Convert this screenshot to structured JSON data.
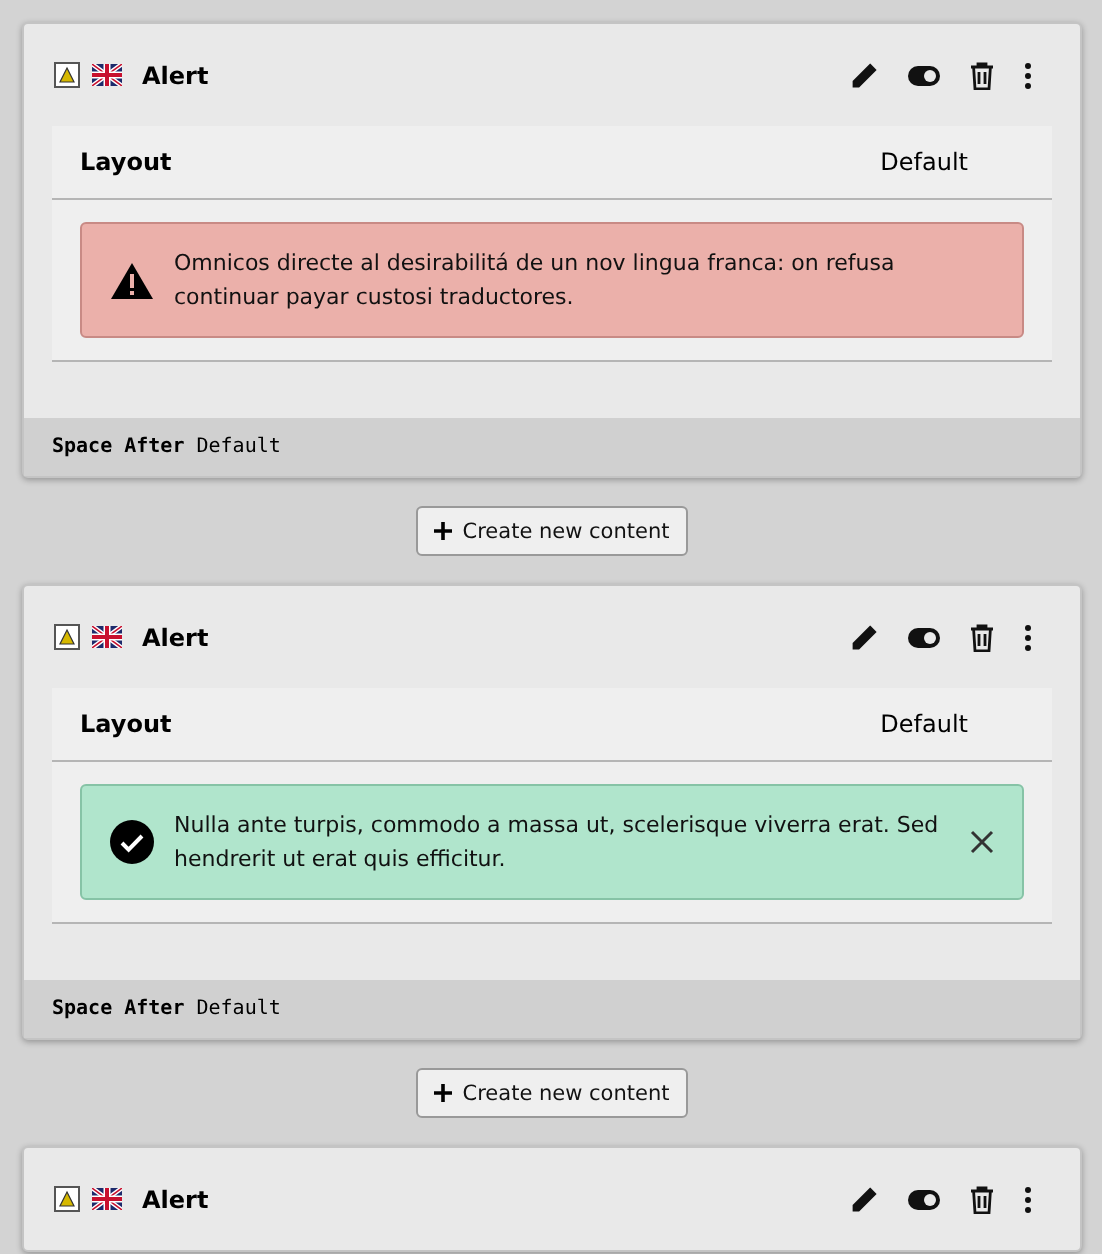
{
  "items": [
    {
      "kind": "card",
      "title": "Alert",
      "layout": {
        "label": "Layout",
        "value": "Default"
      },
      "alert": {
        "kind": "danger",
        "text": "Omnicos directe al desirabilitá de un nov lingua franca: on refusa continuar payar custosi traductores.",
        "dismissible": false
      },
      "footer": {
        "label": "Space After",
        "value": "Default"
      }
    },
    {
      "kind": "create",
      "label": "Create new content"
    },
    {
      "kind": "card",
      "title": "Alert",
      "layout": {
        "label": "Layout",
        "value": "Default"
      },
      "alert": {
        "kind": "success",
        "text": "Nulla ante turpis, commodo a massa ut, scelerisque viverra erat. Sed hendrerit ut erat quis efficitur.",
        "dismissible": true
      },
      "footer": {
        "label": "Space After",
        "value": "Default"
      }
    },
    {
      "kind": "create",
      "label": "Create new content"
    },
    {
      "kind": "card",
      "title": "Alert"
    }
  ]
}
